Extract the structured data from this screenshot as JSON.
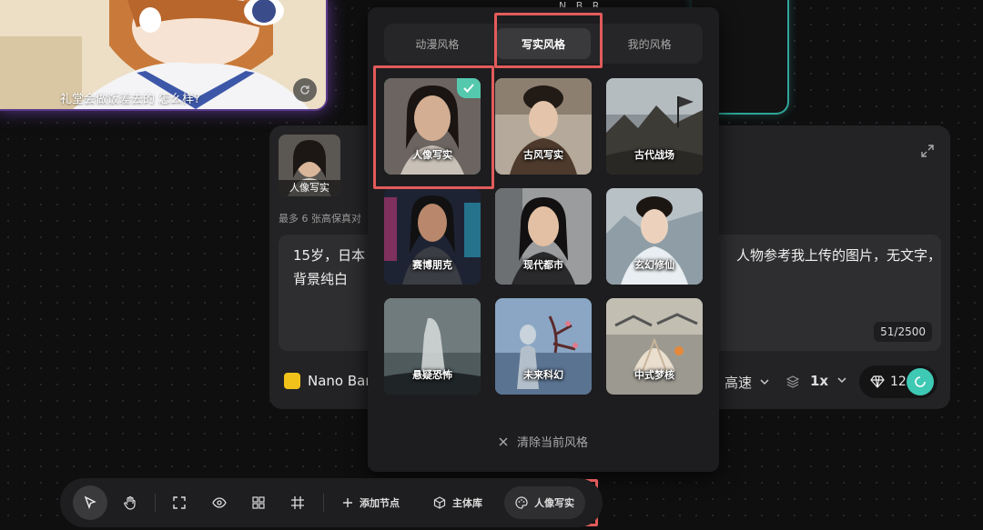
{
  "anime_card": {
    "caption": "礼堂会做饭差去的 怎么样?"
  },
  "top_peek": "N...B...R...",
  "node": {
    "ref_image_label": "人像写实",
    "ref_note": "最多 6 张高保真对",
    "prompt": "15岁，日本……人物参考我上传的图片，无文字，背景纯白",
    "prompt_line1": "15岁，日本",
    "prompt_line1_tail": "人物参考我上传的图片，无文字，",
    "prompt_line2": "背景纯白",
    "counter": "51/2500",
    "model_name": "Nano Bar",
    "speed_label": "高速",
    "multiplier": "1x",
    "cost": "12"
  },
  "picker": {
    "tabs": [
      {
        "label": "动漫风格",
        "active": false
      },
      {
        "label": "写实风格",
        "active": true
      },
      {
        "label": "我的风格",
        "active": false
      }
    ],
    "styles": [
      {
        "label": "人像写实",
        "selected": true
      },
      {
        "label": "古风写实",
        "selected": false
      },
      {
        "label": "古代战场",
        "selected": false
      },
      {
        "label": "赛博朋克",
        "selected": false
      },
      {
        "label": "现代都市",
        "selected": false
      },
      {
        "label": "玄幻修仙",
        "selected": false
      },
      {
        "label": "悬疑恐怖",
        "selected": false
      },
      {
        "label": "未来科幻",
        "selected": false
      },
      {
        "label": "中式梦核",
        "selected": false
      }
    ],
    "clear_label": "清除当前风格"
  },
  "toolbar": {
    "add_node": "添加节点",
    "subject_lib": "主体库",
    "style": "人像写实"
  },
  "colors": {
    "accent": "#55c9ae",
    "highlight": "#e25b5b",
    "panel": "#232325",
    "picker": "#1d1d1f"
  }
}
